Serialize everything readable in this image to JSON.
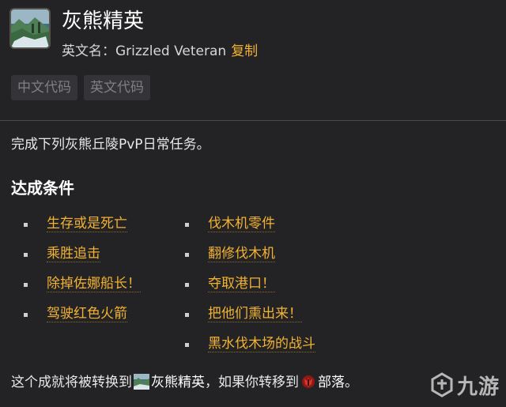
{
  "achievement": {
    "title": "灰熊精英",
    "english_label": "英文名：",
    "english_name": "Grizzled Veteran",
    "copy_label": "复制",
    "icon": "landscape-achievement-icon"
  },
  "code_buttons": [
    {
      "label": "中文代码"
    },
    {
      "label": "英文代码"
    }
  ],
  "description": "完成下列灰熊丘陵PvP日常任务。",
  "criteria": {
    "heading": "达成条件",
    "left": [
      {
        "label": "生存或是死亡"
      },
      {
        "label": "乘胜追击"
      },
      {
        "label": "除掉佐娜船长！"
      },
      {
        "label": "驾驶红色火箭"
      }
    ],
    "right": [
      {
        "label": "伐木机零件"
      },
      {
        "label": "翻修伐木机"
      },
      {
        "label": "夺取港口！"
      },
      {
        "label": "把他们熏出来！"
      },
      {
        "label": "黑水伐木场的战斗"
      }
    ]
  },
  "footer": {
    "prefix": "这个成就将被转换到",
    "achievement_name": "灰熊精英",
    "middle": "，如果你转移到",
    "faction": "部落",
    "suffix": "。",
    "achievement_icon": "landscape-achievement-icon",
    "faction_icon": "horde-icon"
  },
  "watermark": {
    "text": "九游",
    "icon": "jiuyou-logo-icon"
  },
  "colors": {
    "background": "#232325",
    "link": "#f2b233",
    "button_bg": "#343438",
    "button_text": "#7f7f84"
  }
}
